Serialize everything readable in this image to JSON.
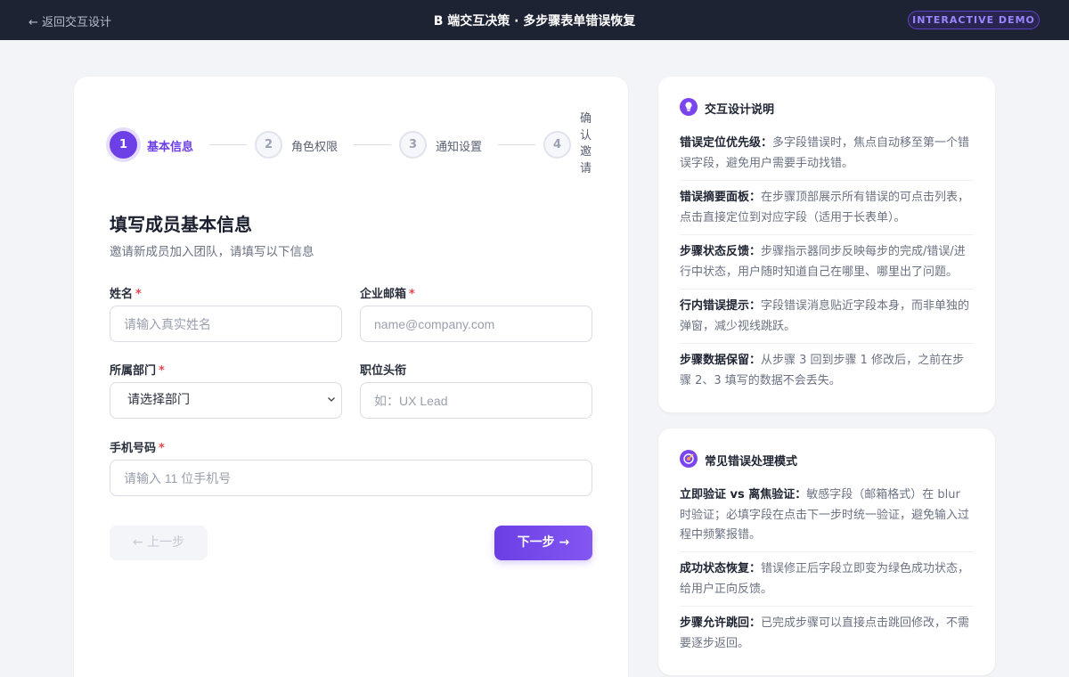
{
  "topbar": {
    "back_label": "← 返回交互设计",
    "title": "B 端交互决策 · 多步骤表单错误恢复",
    "badge": "INTERACTIVE DEMO"
  },
  "steps": [
    {
      "number": "1",
      "label": "基本信息",
      "state": "active"
    },
    {
      "number": "2",
      "label": "角色权限",
      "state": "pending"
    },
    {
      "number": "3",
      "label": "通知设置",
      "state": "pending"
    },
    {
      "number": "4",
      "label": "确认邀请",
      "state": "pending"
    }
  ],
  "form": {
    "title": "填写成员基本信息",
    "subtitle": "邀请新成员加入团队，请填写以下信息",
    "required_mark": "*",
    "name": {
      "label": "姓名",
      "placeholder": "请输入真实姓名"
    },
    "email": {
      "label": "企业邮箱",
      "placeholder": "name@company.com"
    },
    "department": {
      "label": "所属部门",
      "value": "请选择部门"
    },
    "position": {
      "label": "职位头衔",
      "placeholder": "如：UX Lead"
    },
    "phone": {
      "label": "手机号码",
      "placeholder": "请输入 11 位手机号"
    },
    "prev_label": "← 上一步",
    "next_label": "下一步 →"
  },
  "design_notes": {
    "title": "交互设计说明",
    "icon": "lightbulb-icon",
    "items": [
      {
        "term": "错误定位优先级：",
        "text": "多字段错误时，焦点自动移至第一个错误字段，避免用户需要手动找错。"
      },
      {
        "term": "错误摘要面板：",
        "text": "在步骤顶部展示所有错误的可点击列表，点击直接定位到对应字段（适用于长表单）。"
      },
      {
        "term": "步骤状态反馈：",
        "text": "步骤指示器同步反映每步的完成/错误/进行中状态，用户随时知道自己在哪里、哪里出了问题。"
      },
      {
        "term": "行内错误提示：",
        "text": "字段错误消息贴近字段本身，而非单独的弹窗，减少视线跳跃。"
      },
      {
        "term": "步骤数据保留：",
        "text": "从步骤 3 回到步骤 1 修改后，之前在步骤 2、3 填写的数据不会丢失。"
      }
    ]
  },
  "error_patterns": {
    "title": "常见错误处理模式",
    "icon": "target-icon",
    "items": [
      {
        "term": "立即验证 vs 离焦验证：",
        "text": "敏感字段（邮箱格式）在 blur 时验证；必填字段在点击下一步时统一验证，避免输入过程中频繁报错。"
      },
      {
        "term": "成功状态恢复：",
        "text": "错误修正后字段立即变为绿色成功状态，给用户正向反馈。"
      },
      {
        "term": "步骤允许跳回：",
        "text": "已完成步骤可以直接点击跳回修改，不需要逐步返回。"
      }
    ]
  },
  "colors": {
    "accent": "#6d3fe6",
    "topbar": "#1e2334",
    "required": "#e5484d"
  }
}
